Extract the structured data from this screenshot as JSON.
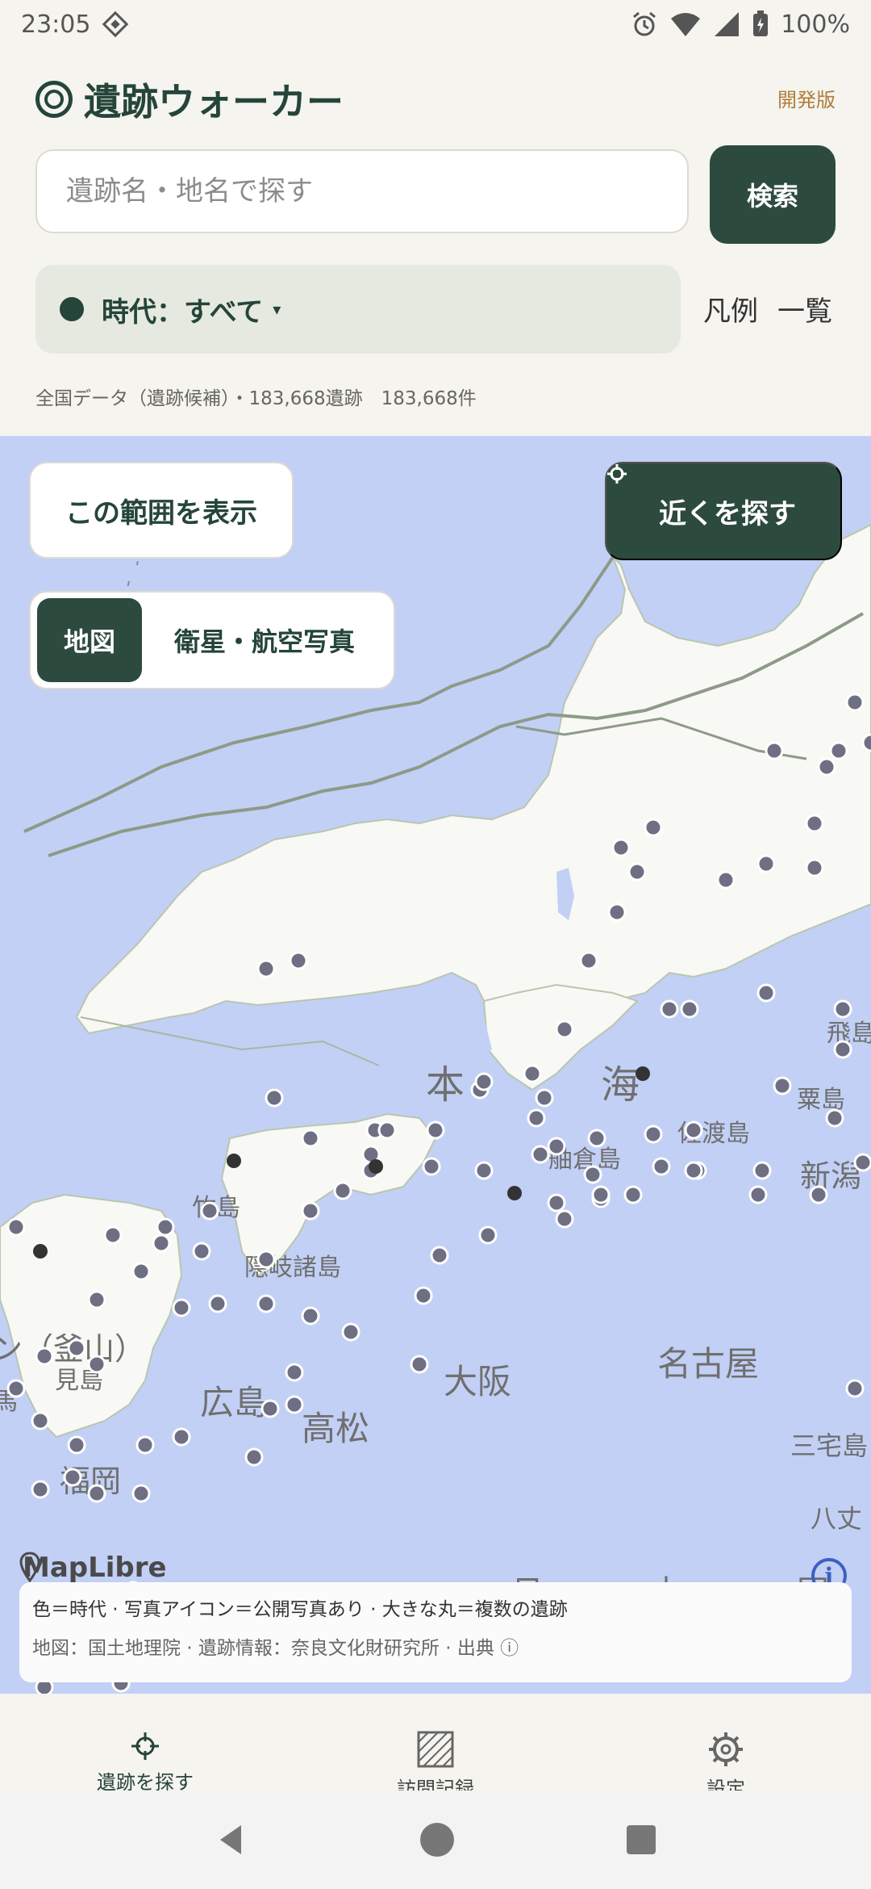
{
  "status_bar": {
    "time": "23:05",
    "battery": "100%"
  },
  "header": {
    "title": "遺跡ウォーカー",
    "badge": "開発版",
    "search": {
      "placeholder": "遺跡名・地名で探す",
      "button": "検索"
    },
    "era_filter": "時代：すべて",
    "era_caret": "▾",
    "legend": "凡例",
    "list": "一覧",
    "data_info": "全国データ（遺跡候補）・183,668遺跡　183,668件"
  },
  "map": {
    "show_area_button": "この範囲を表示",
    "nearby_button": "近くを探す",
    "layers": {
      "map": "地図",
      "satellite": "衛星・航空写真"
    },
    "labels": [
      "飛島",
      "本",
      "海",
      "粟島",
      "佐渡島",
      "舳倉島",
      "新潟",
      "竹島",
      "隠岐諸島",
      "ン（釜山）",
      "見島",
      "広島",
      "大阪",
      "名古屋",
      "高松",
      "福岡",
      "三宅島",
      "八丈",
      "日",
      "本",
      "国",
      "馬"
    ],
    "logo": "MapLibre",
    "info": "i",
    "attribution_line1": "色＝時代 · 写真アイコン＝公開写真あり · 大きな丸＝複数の遺跡",
    "attribution_line2": "地図：国土地理院 · 遺跡情報：奈良文化財研究所 · 出典 ⓘ"
  },
  "bottom_nav": [
    {
      "label": "遺跡を探す",
      "icon": "crosshair-icon"
    },
    {
      "label": "訪問記録",
      "icon": "stamp-grid-icon"
    },
    {
      "label": "設定",
      "icon": "gear-icon"
    }
  ],
  "colors": {
    "primary": "#2d4a3e",
    "sea": "#c2d0f5",
    "land": "#f8f8f4",
    "marker": "#6e6f82",
    "accent": "#b07c3a"
  }
}
